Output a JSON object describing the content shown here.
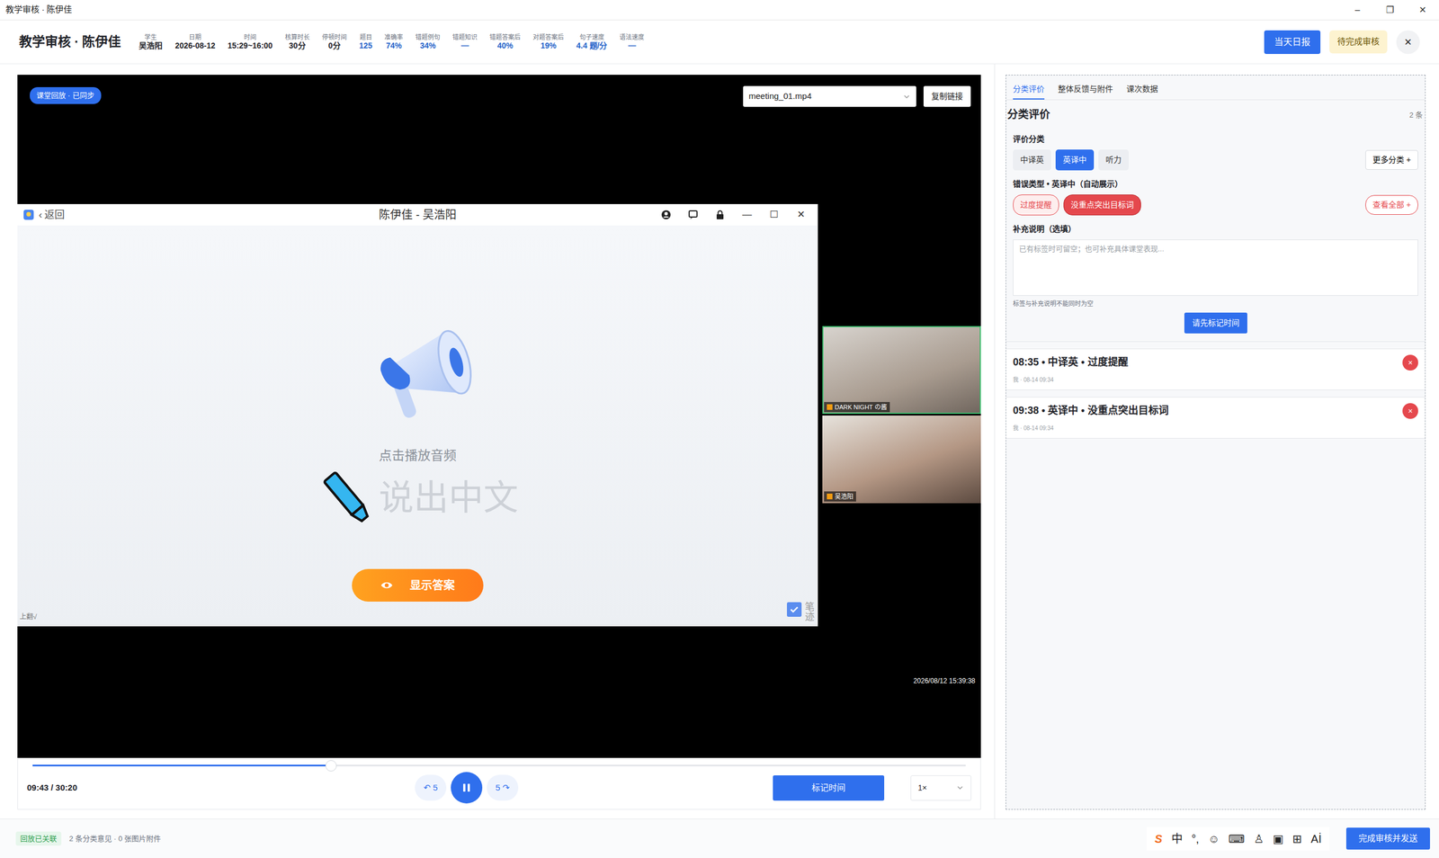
{
  "window": {
    "title": "教学审核 · 陈伊佳",
    "controls": [
      "–",
      "❐",
      "✕"
    ]
  },
  "header": {
    "title": "教学审核 · 陈伊佳",
    "stats": [
      {
        "label": "学生",
        "value": "吴浩阳",
        "kind": "plain"
      },
      {
        "label": "日期",
        "value": "2026-08-12",
        "kind": "plain"
      },
      {
        "label": "时间",
        "value": "15:29~16:00",
        "kind": "plain"
      },
      {
        "label": "核算时长",
        "value": "30分",
        "kind": "plain"
      },
      {
        "label": "停顿时间",
        "value": "0分",
        "kind": "plain"
      },
      {
        "label": "题目",
        "value": "125",
        "kind": "metric"
      },
      {
        "label": "准确率",
        "value": "74%",
        "kind": "metric"
      },
      {
        "label": "错题例句",
        "value": "34%",
        "kind": "metric"
      },
      {
        "label": "错题知识",
        "value": "—",
        "kind": "metric"
      },
      {
        "label": "错题答案后",
        "value": "40%",
        "kind": "metric"
      },
      {
        "label": "对题答案后",
        "value": "19%",
        "kind": "metric"
      },
      {
        "label": "句子速度",
        "value": "4.4 题/分",
        "kind": "metric"
      },
      {
        "label": "语法速度",
        "value": "—",
        "kind": "metric"
      }
    ],
    "report_button": "当天日报",
    "status_badge": "待完成审核",
    "close": "×"
  },
  "player": {
    "badge": "课堂回放 · 已同步",
    "file": "meeting_01.mp4",
    "copy_button": "复制链接",
    "timestamp": "2026/08/12 15:39:38",
    "app": {
      "back_icon": "‹",
      "back": "返回",
      "title": "陈伊佳 - 吴浩阳",
      "controls": [
        "—",
        "☐",
        "✕"
      ],
      "prompt": "点击播放音频",
      "word": "说出中文",
      "answer_button": "显示答案",
      "corner_left": "上翻√",
      "pen_label": "笔迹",
      "pen_checked": true
    },
    "participants": [
      {
        "name": "DARK NIGHT の酱",
        "speaking": true
      },
      {
        "name": "吴浩阳",
        "speaking": false
      }
    ],
    "controls": {
      "time": "09:43 / 30:20",
      "level": 0.32,
      "back": "↶ 5",
      "forward": "5 ↷",
      "playing": true,
      "mark_button": "标记时间",
      "speed": "1×"
    }
  },
  "review": {
    "tabs": [
      {
        "label": "分类评价",
        "selected": true
      },
      {
        "label": "整体反馈与附件",
        "selected": false
      },
      {
        "label": "课次数据",
        "selected": false
      }
    ],
    "title": "分类评价",
    "count": "2 条",
    "category_label": "评价分类",
    "categories": [
      {
        "label": "中译英",
        "selected": false
      },
      {
        "label": "英译中",
        "selected": true
      },
      {
        "label": "听力",
        "selected": false
      }
    ],
    "more_button": "更多分类 +",
    "error_label": "错误类型 • 英译中（自动展示）",
    "errors": [
      {
        "label": "过度提醒",
        "selected": false
      },
      {
        "label": "没重点突出目标词",
        "selected": true
      }
    ],
    "view_all": "查看全部 +",
    "note_label": "补充说明（选填）",
    "note_placeholder": "已有标签时可留空；也可补充具体课堂表现...",
    "hint": "标签与补充说明不能同时为空",
    "submit_button": "请先标记时间",
    "entries": [
      {
        "title": "08:35 • 中译英 • 过度提醒",
        "meta": "我 · 08-14 09:34",
        "delete": "×"
      },
      {
        "title": "09:38 • 英译中 • 没重点突出目标词",
        "meta": "我 · 08-14 09:34",
        "delete": "×"
      }
    ]
  },
  "footer": {
    "badge": "回放已关联",
    "summary": "2 条分类意见 · 0 张图片附件",
    "ime": [
      {
        "glyph": "S",
        "kind": "logo"
      },
      {
        "glyph": "中",
        "kind": "text"
      },
      {
        "glyph": "°,",
        "kind": "text"
      },
      {
        "glyph": "☺",
        "kind": "text"
      },
      {
        "glyph": "⌨",
        "kind": "text"
      },
      {
        "glyph": "♙",
        "kind": "text"
      },
      {
        "glyph": "▣",
        "kind": "text"
      },
      {
        "glyph": "⊞",
        "kind": "text"
      },
      {
        "glyph": "Aİ",
        "kind": "text"
      }
    ],
    "send_button": "完成审核并发送"
  }
}
